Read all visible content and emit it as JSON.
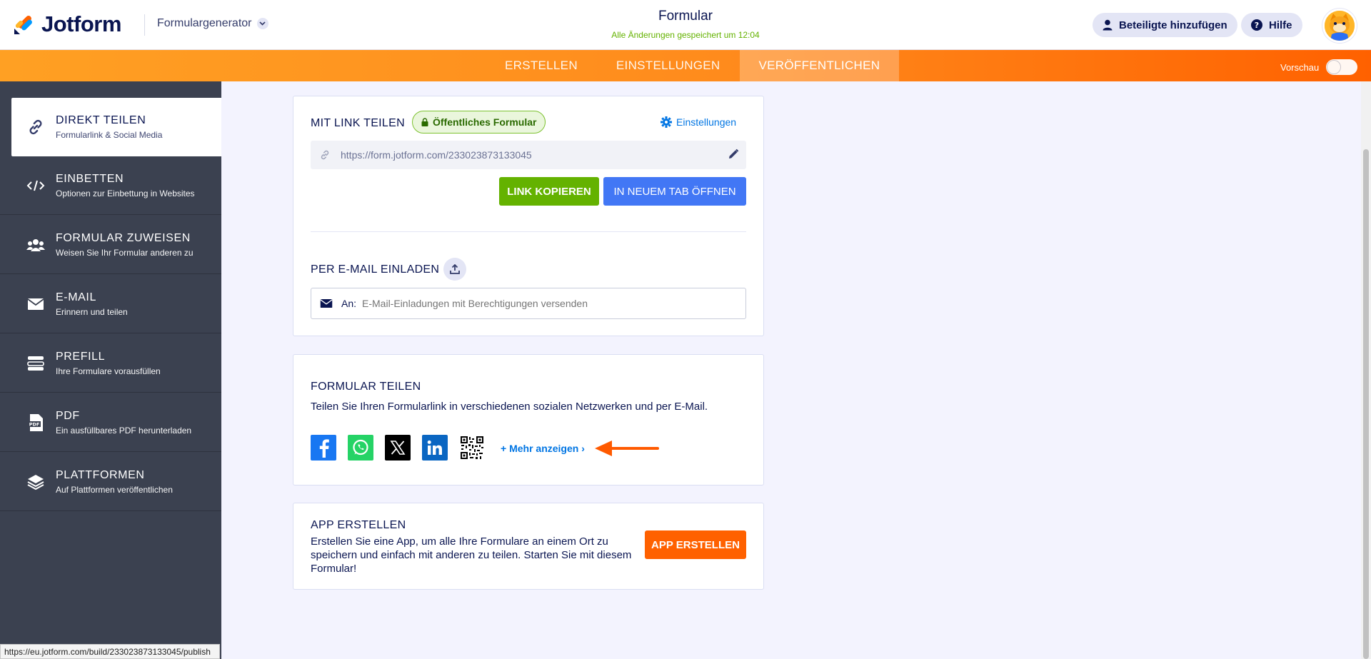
{
  "header": {
    "logo_text": "Jotform",
    "builder_label": "Formulargenerator",
    "form_title": "Formular",
    "save_status": "Alle Änderungen gespeichert um 12:04",
    "add_participants": "Beteiligte hinzufügen",
    "help": "Hilfe"
  },
  "nav": {
    "tabs": [
      {
        "label": "ERSTELLEN"
      },
      {
        "label": "EINSTELLUNGEN"
      },
      {
        "label": "VERÖFFENTLICHEN"
      }
    ],
    "active_tab": "VERÖFFENTLICHEN",
    "preview_label": "Vorschau",
    "preview_on": false
  },
  "sidebar": {
    "items": [
      {
        "title": "DIREKT TEILEN",
        "subtitle": "Formularlink & Social Media",
        "icon": "link-icon"
      },
      {
        "title": "EINBETTEN",
        "subtitle": "Optionen zur Einbettung in Websites",
        "icon": "code-icon"
      },
      {
        "title": "FORMULAR ZUWEISEN",
        "subtitle": "Weisen Sie Ihr Formular anderen zu",
        "icon": "users-icon"
      },
      {
        "title": "E-MAIL",
        "subtitle": "Erinnern und teilen",
        "icon": "envelope-icon"
      },
      {
        "title": "PREFILL",
        "subtitle": "Ihre Formulare vorausfüllen",
        "icon": "prefill-icon"
      },
      {
        "title": "PDF",
        "subtitle": "Ein ausfüllbares PDF herunterladen",
        "icon": "pdf-icon"
      },
      {
        "title": "PLATTFORMEN",
        "subtitle": "Auf Plattformen veröffentlichen",
        "icon": "layers-icon"
      }
    ],
    "active_index": 0
  },
  "link_card": {
    "heading": "MIT LINK TEILEN",
    "badge": "Öffentliches Formular",
    "settings": "Einstellungen",
    "url": "https://form.jotform.com/233023873133045",
    "copy_button": "LINK KOPIEREN",
    "newtab_button": "IN NEUEM TAB ÖFFNEN",
    "invite_heading": "PER E-MAIL EINLADEN",
    "to_label": "An:",
    "email_placeholder": "E-Mail-Einladungen mit Berechtigungen versenden"
  },
  "share_card": {
    "heading": "FORMULAR TEILEN",
    "description": "Teilen Sie Ihren Formularlink in verschiedenen sozialen Netzwerken und per E-Mail.",
    "networks": [
      "facebook-icon",
      "whatsapp-icon",
      "x-icon",
      "linkedin-icon",
      "qr-code-icon"
    ],
    "more_link": "+ Mehr anzeigen ›"
  },
  "app_card": {
    "heading": "APP ERSTELLEN",
    "description": "Erstellen Sie eine App, um alle Ihre Formulare an einem Ort zu speichern und einfach mit anderen zu teilen. Starten Sie mit diesem Formular!",
    "button": "APP ERSTELLEN"
  },
  "status_bar_url": "https://eu.jotform.com/build/233023873133045/publish",
  "colors": {
    "brand_dark": "#0a1551",
    "orange": "#ff6100",
    "green": "#64b200",
    "blue": "#4277f5",
    "sidebar": "#3b4150"
  }
}
